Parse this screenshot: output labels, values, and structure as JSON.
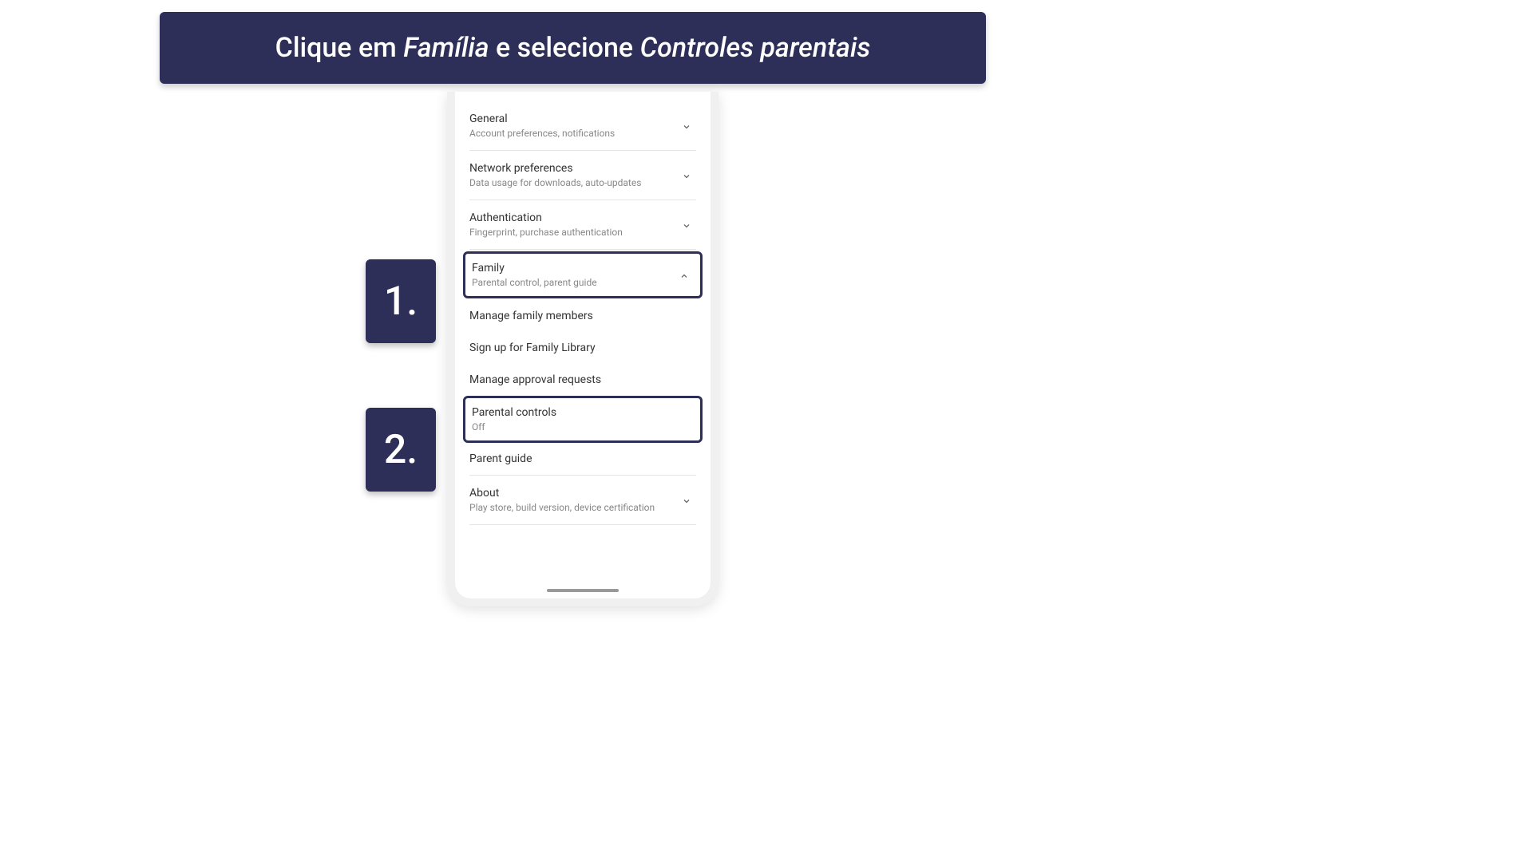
{
  "instruction": {
    "prefix": "Clique em ",
    "em1": "Família",
    "middle": " e selecione ",
    "em2": "Controles parentais"
  },
  "steps": {
    "one": "1.",
    "two": "2."
  },
  "settings": {
    "general": {
      "title": "General",
      "subtitle": "Account preferences, notifications"
    },
    "network": {
      "title": "Network preferences",
      "subtitle": "Data usage for downloads, auto-updates"
    },
    "authentication": {
      "title": "Authentication",
      "subtitle": "Fingerprint, purchase authentication"
    },
    "family": {
      "title": "Family",
      "subtitle": "Parental control, parent guide",
      "children": {
        "manage_members": "Manage family members",
        "signup_library": "Sign up for Family Library",
        "manage_requests": "Manage approval requests",
        "parental_controls": {
          "title": "Parental controls",
          "status": "Off"
        },
        "parent_guide": "Parent guide"
      }
    },
    "about": {
      "title": "About",
      "subtitle": "Play store, build version, device certification"
    }
  }
}
